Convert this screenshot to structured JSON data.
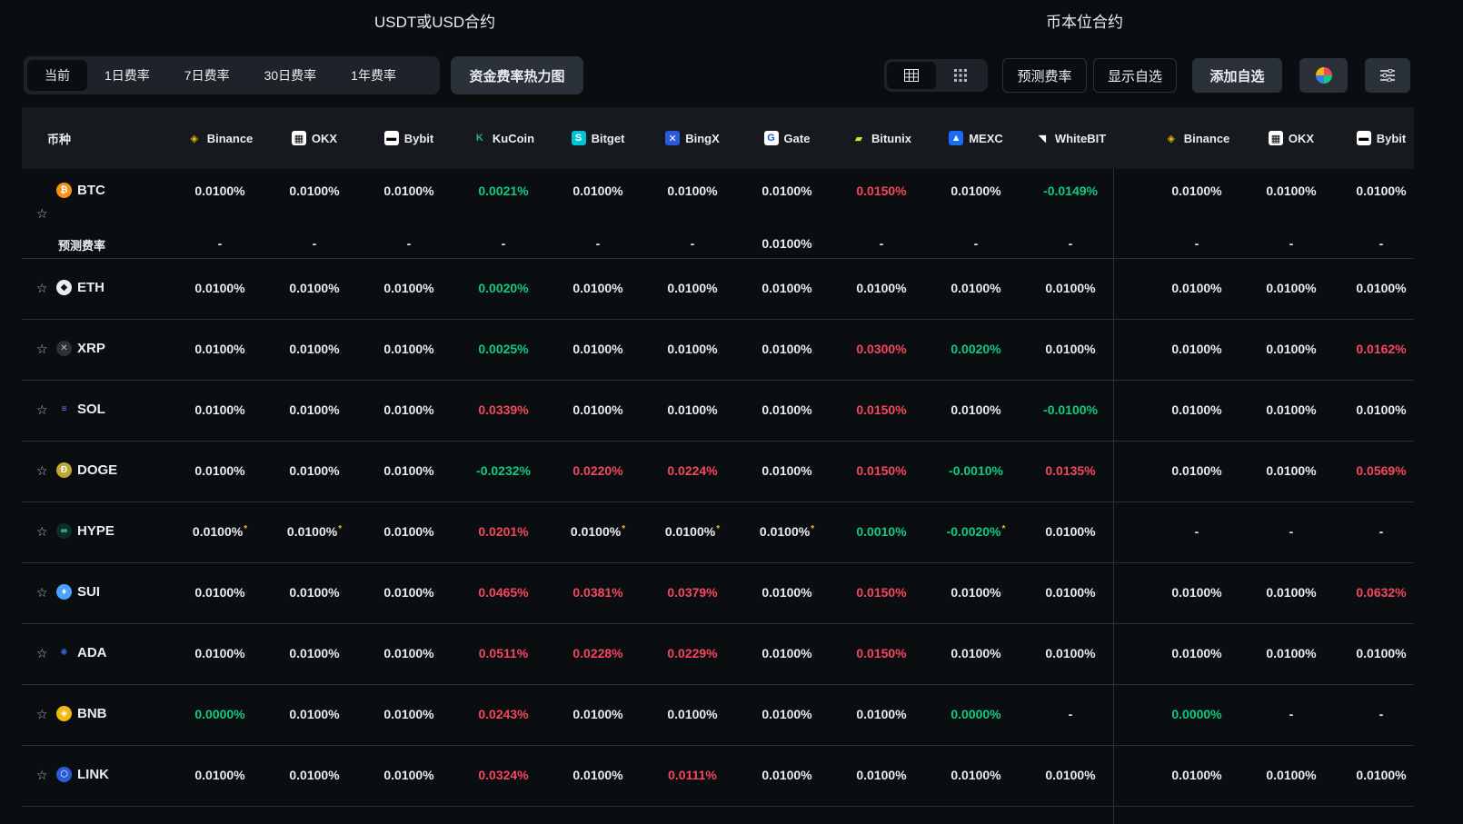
{
  "titles": {
    "usdt": "USDT或USD合约",
    "coin": "币本位合约"
  },
  "period_tabs": [
    "当前",
    "1日费率",
    "7日费率",
    "30日费率",
    "1年费率"
  ],
  "heatmap_label": "资金费率热力图",
  "buttons": {
    "forecast": "预测费率",
    "show_watch": "显示自选",
    "add_watch": "添加自选"
  },
  "header": {
    "coin_col": "币种",
    "exchanges": [
      "Binance",
      "OKX",
      "Bybit",
      "KuCoin",
      "Bitget",
      "BingX",
      "Gate",
      "Bitunix",
      "MEXC",
      "WhiteBIT",
      "Binance",
      "OKX",
      "Bybit"
    ]
  },
  "forecast_label": "预测费率",
  "rows": [
    {
      "coin": "BTC",
      "rates": [
        [
          "0.0100%",
          ""
        ],
        [
          "0.0100%",
          ""
        ],
        [
          "0.0100%",
          ""
        ],
        [
          "0.0021%",
          "green"
        ],
        [
          "0.0100%",
          ""
        ],
        [
          "0.0100%",
          ""
        ],
        [
          "0.0100%",
          ""
        ],
        [
          "0.0150%",
          "red"
        ],
        [
          "0.0100%",
          ""
        ],
        [
          "-0.0149%",
          "green"
        ],
        [
          "0.0100%",
          ""
        ],
        [
          "0.0100%",
          ""
        ],
        [
          "0.0100%",
          ""
        ]
      ],
      "forecast": [
        "-",
        "-",
        "-",
        "-",
        "-",
        "-",
        "0.0100%",
        "-",
        "-",
        "-",
        "-",
        "-",
        "-"
      ]
    },
    {
      "coin": "ETH",
      "rates": [
        [
          "0.0100%",
          ""
        ],
        [
          "0.0100%",
          ""
        ],
        [
          "0.0100%",
          ""
        ],
        [
          "0.0020%",
          "green"
        ],
        [
          "0.0100%",
          ""
        ],
        [
          "0.0100%",
          ""
        ],
        [
          "0.0100%",
          ""
        ],
        [
          "0.0100%",
          ""
        ],
        [
          "0.0100%",
          ""
        ],
        [
          "0.0100%",
          ""
        ],
        [
          "0.0100%",
          ""
        ],
        [
          "0.0100%",
          ""
        ],
        [
          "0.0100%",
          ""
        ]
      ]
    },
    {
      "coin": "XRP",
      "rates": [
        [
          "0.0100%",
          ""
        ],
        [
          "0.0100%",
          ""
        ],
        [
          "0.0100%",
          ""
        ],
        [
          "0.0025%",
          "green"
        ],
        [
          "0.0100%",
          ""
        ],
        [
          "0.0100%",
          ""
        ],
        [
          "0.0100%",
          ""
        ],
        [
          "0.0300%",
          "red"
        ],
        [
          "0.0020%",
          "green"
        ],
        [
          "0.0100%",
          ""
        ],
        [
          "0.0100%",
          ""
        ],
        [
          "0.0100%",
          ""
        ],
        [
          "0.0162%",
          "red"
        ]
      ]
    },
    {
      "coin": "SOL",
      "rates": [
        [
          "0.0100%",
          ""
        ],
        [
          "0.0100%",
          ""
        ],
        [
          "0.0100%",
          ""
        ],
        [
          "0.0339%",
          "red"
        ],
        [
          "0.0100%",
          ""
        ],
        [
          "0.0100%",
          ""
        ],
        [
          "0.0100%",
          ""
        ],
        [
          "0.0150%",
          "red"
        ],
        [
          "0.0100%",
          ""
        ],
        [
          "-0.0100%",
          "green"
        ],
        [
          "0.0100%",
          ""
        ],
        [
          "0.0100%",
          ""
        ],
        [
          "0.0100%",
          ""
        ]
      ]
    },
    {
      "coin": "DOGE",
      "rates": [
        [
          "0.0100%",
          ""
        ],
        [
          "0.0100%",
          ""
        ],
        [
          "0.0100%",
          ""
        ],
        [
          "-0.0232%",
          "green"
        ],
        [
          "0.0220%",
          "red"
        ],
        [
          "0.0224%",
          "red"
        ],
        [
          "0.0100%",
          ""
        ],
        [
          "0.0150%",
          "red"
        ],
        [
          "-0.0010%",
          "green"
        ],
        [
          "0.0135%",
          "red"
        ],
        [
          "0.0100%",
          ""
        ],
        [
          "0.0100%",
          ""
        ],
        [
          "0.0569%",
          "red"
        ]
      ]
    },
    {
      "coin": "HYPE",
      "rates": [
        [
          "0.0100%",
          "",
          "*"
        ],
        [
          "0.0100%",
          "",
          "*"
        ],
        [
          "0.0100%",
          ""
        ],
        [
          "0.0201%",
          "red"
        ],
        [
          "0.0100%",
          "",
          "*"
        ],
        [
          "0.0100%",
          "",
          "*"
        ],
        [
          "0.0100%",
          "",
          "*"
        ],
        [
          "0.0010%",
          "green"
        ],
        [
          "-0.0020%",
          "green",
          "*"
        ],
        [
          "0.0100%",
          ""
        ],
        [
          "-",
          ""
        ],
        [
          "-",
          ""
        ],
        [
          "-",
          ""
        ]
      ]
    },
    {
      "coin": "SUI",
      "rates": [
        [
          "0.0100%",
          ""
        ],
        [
          "0.0100%",
          ""
        ],
        [
          "0.0100%",
          ""
        ],
        [
          "0.0465%",
          "red"
        ],
        [
          "0.0381%",
          "red"
        ],
        [
          "0.0379%",
          "red"
        ],
        [
          "0.0100%",
          ""
        ],
        [
          "0.0150%",
          "red"
        ],
        [
          "0.0100%",
          ""
        ],
        [
          "0.0100%",
          ""
        ],
        [
          "0.0100%",
          ""
        ],
        [
          "0.0100%",
          ""
        ],
        [
          "0.0632%",
          "red"
        ]
      ]
    },
    {
      "coin": "ADA",
      "rates": [
        [
          "0.0100%",
          ""
        ],
        [
          "0.0100%",
          ""
        ],
        [
          "0.0100%",
          ""
        ],
        [
          "0.0511%",
          "red"
        ],
        [
          "0.0228%",
          "red"
        ],
        [
          "0.0229%",
          "red"
        ],
        [
          "0.0100%",
          ""
        ],
        [
          "0.0150%",
          "red"
        ],
        [
          "0.0100%",
          ""
        ],
        [
          "0.0100%",
          ""
        ],
        [
          "0.0100%",
          ""
        ],
        [
          "0.0100%",
          ""
        ],
        [
          "0.0100%",
          ""
        ]
      ]
    },
    {
      "coin": "BNB",
      "rates": [
        [
          "0.0000%",
          "green"
        ],
        [
          "0.0100%",
          ""
        ],
        [
          "0.0100%",
          ""
        ],
        [
          "0.0243%",
          "red"
        ],
        [
          "0.0100%",
          ""
        ],
        [
          "0.0100%",
          ""
        ],
        [
          "0.0100%",
          ""
        ],
        [
          "0.0100%",
          ""
        ],
        [
          "0.0000%",
          "green"
        ],
        [
          "-",
          ""
        ],
        [
          "0.0000%",
          "green"
        ],
        [
          "-",
          ""
        ],
        [
          "-",
          ""
        ]
      ]
    },
    {
      "coin": "LINK",
      "rates": [
        [
          "0.0100%",
          ""
        ],
        [
          "0.0100%",
          ""
        ],
        [
          "0.0100%",
          ""
        ],
        [
          "0.0324%",
          "red"
        ],
        [
          "0.0100%",
          ""
        ],
        [
          "0.0111%",
          "red"
        ],
        [
          "0.0100%",
          ""
        ],
        [
          "0.0100%",
          ""
        ],
        [
          "0.0100%",
          ""
        ],
        [
          "0.0100%",
          ""
        ],
        [
          "0.0100%",
          ""
        ],
        [
          "0.0100%",
          ""
        ],
        [
          "0.0100%",
          ""
        ]
      ]
    }
  ],
  "colors": {
    "green": "#0ecb81",
    "red": "#f6465d",
    "accent": "#f0b90b"
  }
}
